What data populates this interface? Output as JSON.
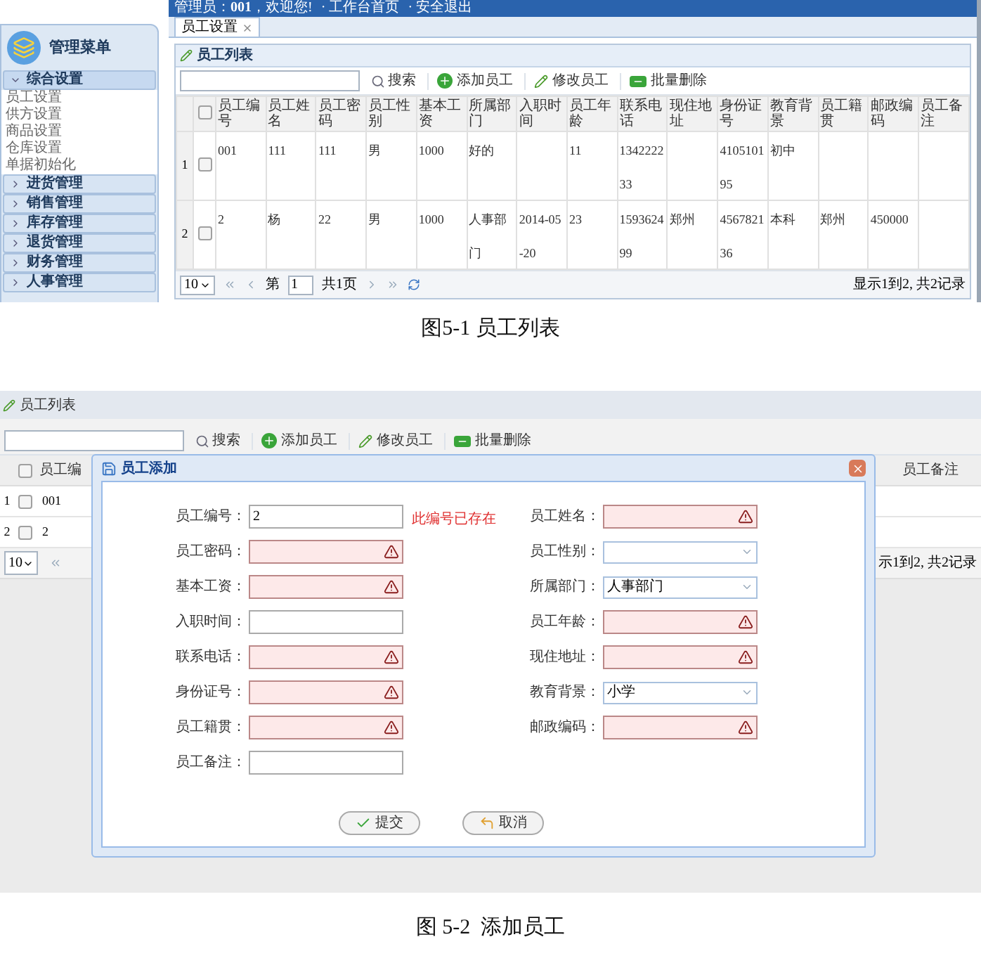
{
  "figure_1": {
    "top_bar": {
      "user_label": "管理员：",
      "user_id": "001",
      "greeting": "，欢迎您!",
      "separator": "·",
      "links": [
        "工作台首页",
        "安全退出"
      ]
    },
    "sidebar": {
      "title": "管理菜单",
      "sections": [
        {
          "label": "综合设置",
          "expanded": true,
          "items": [
            "员工设置",
            "供方设置",
            "商品设置",
            "仓库设置",
            "单据初始化"
          ]
        },
        {
          "label": "进货管理",
          "expanded": false
        },
        {
          "label": "销售管理",
          "expanded": false
        },
        {
          "label": "库存管理",
          "expanded": false
        },
        {
          "label": "退货管理",
          "expanded": false
        },
        {
          "label": "财务管理",
          "expanded": false
        },
        {
          "label": "人事管理",
          "expanded": false
        }
      ]
    },
    "tabs": [
      {
        "label": "员工设置",
        "selected": true
      }
    ],
    "panel_title": "员工列表",
    "toolbar": {
      "search_label": "搜索",
      "buttons": [
        {
          "kind": "add",
          "label": "添加员工"
        },
        {
          "kind": "edit",
          "label": "修改员工"
        },
        {
          "kind": "delete",
          "label": "批量删除"
        }
      ]
    },
    "table": {
      "header_checked": false,
      "columns": [
        "员工编号",
        "员工姓名",
        "员工密码",
        "员工性别",
        "基本工资",
        "所属部门",
        "入职时间",
        "员工年龄",
        "联系电话",
        "现住地址",
        "身份证号",
        "教育背景",
        "员工籍贯",
        "邮政编码",
        "员工备注"
      ],
      "rows": [
        {
          "number": "1",
          "checked": false,
          "cells": [
            "001",
            "111",
            "111",
            "男",
            "1000",
            "好的",
            null,
            "11",
            "134222233",
            null,
            "410510195",
            "初中",
            null,
            null,
            null
          ]
        },
        {
          "number": "2",
          "checked": false,
          "cells": [
            "2",
            "杨",
            "22",
            "男",
            "1000",
            "人事部门",
            "2014-05-20",
            "23",
            "159362499",
            "郑州",
            "456782136",
            "本科",
            "郑州",
            "450000",
            null
          ]
        }
      ]
    },
    "pager": {
      "page_size": "10",
      "page_prefix": "第",
      "page": "1",
      "page_total": "共1页",
      "summary": "显示1到2, 共2记录"
    },
    "caption": "图5-1 员工列表"
  },
  "figure_2": {
    "background": {
      "panel_title": "员工列表",
      "search_label": "搜索",
      "buttons": [
        {
          "kind": "add",
          "label": "添加员工"
        },
        {
          "kind": "edit",
          "label": "修改员工"
        },
        {
          "kind": "delete",
          "label": "批量删除"
        }
      ],
      "header_checked": false,
      "first_column": "员工编",
      "last_column": "员工备注",
      "rows": [
        {
          "number": "1",
          "checked": false,
          "value": "001"
        },
        {
          "number": "2",
          "checked": false,
          "value": "2"
        }
      ],
      "page_size": "10",
      "summary": "示1到2, 共2记录"
    },
    "dialog": {
      "title": "员工添加",
      "left_fields": [
        {
          "label": "员工编号：",
          "kind": "text",
          "value": "2",
          "invalid": false,
          "error": "此编号已存在"
        },
        {
          "label": "员工密码：",
          "kind": "text",
          "invalid": true
        },
        {
          "label": "基本工资：",
          "kind": "text",
          "invalid": true
        },
        {
          "label": "入职时间：",
          "kind": "text",
          "invalid": false
        },
        {
          "label": "联系电话：",
          "kind": "text",
          "invalid": true
        },
        {
          "label": "身份证号：",
          "kind": "text",
          "invalid": true
        },
        {
          "label": "员工籍贯：",
          "kind": "text",
          "invalid": true
        },
        {
          "label": "员工备注：",
          "kind": "text",
          "invalid": false
        }
      ],
      "right_fields": [
        {
          "label": "员工姓名：",
          "kind": "text",
          "invalid": true
        },
        {
          "label": "员工性别：",
          "kind": "select",
          "invalid": false
        },
        {
          "label": "所属部门：",
          "kind": "select",
          "value": "人事部门",
          "invalid": false
        },
        {
          "label": "员工年龄：",
          "kind": "text",
          "invalid": true
        },
        {
          "label": "现住地址：",
          "kind": "text",
          "invalid": true
        },
        {
          "label": "教育背景：",
          "kind": "select",
          "value": "小学",
          "invalid": false
        },
        {
          "label": "邮政编码：",
          "kind": "text",
          "invalid": true
        }
      ],
      "buttons": [
        {
          "kind": "submit",
          "label": "提交"
        },
        {
          "kind": "cancel",
          "label": "取消"
        }
      ]
    },
    "caption": "图 5-2  添加员工"
  }
}
